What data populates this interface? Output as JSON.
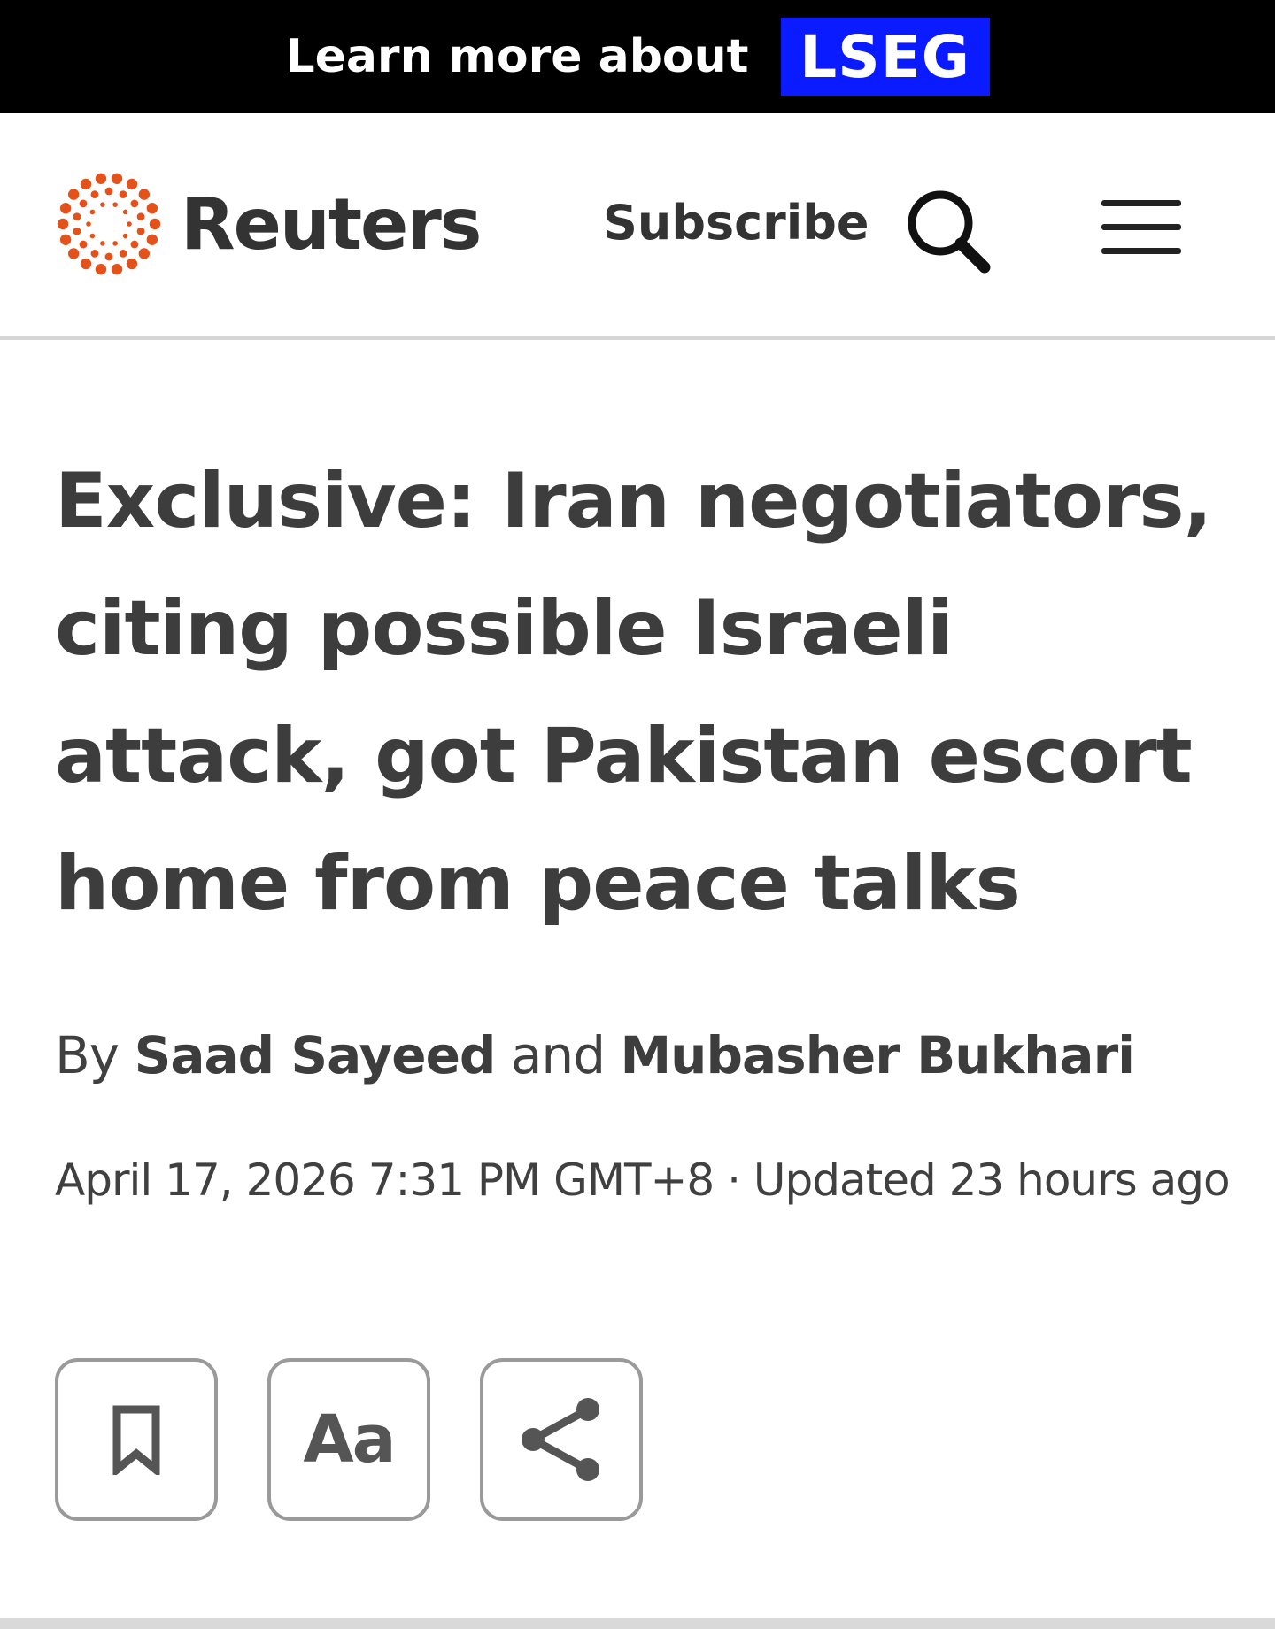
{
  "ad_banner": {
    "text": "Learn more about",
    "brand": "LSEG",
    "background_color": "#000000",
    "brand_color": "#0a1bff"
  },
  "header": {
    "logo_text": "Reuters",
    "logo_color": "#e4521b",
    "subscribe_label": "Subscribe",
    "search_icon": "search-icon",
    "menu_icon": "hamburger-menu-icon"
  },
  "article": {
    "headline": "Exclusive: Iran negotiators, citing possible Israeli attack, got Pakistan escort home from peace talks",
    "byline": {
      "prefix": "By",
      "author_1": "Saad Sayeed",
      "conjunction": "and",
      "author_2": "Mubasher Bukhari"
    },
    "dateline": "April 17, 2026 7:31 PM GMT+8 · Updated 23 hours ago"
  },
  "tools": {
    "bookmark_icon": "bookmark-icon",
    "text_size_label": "Aa",
    "share_icon": "share-icon"
  }
}
